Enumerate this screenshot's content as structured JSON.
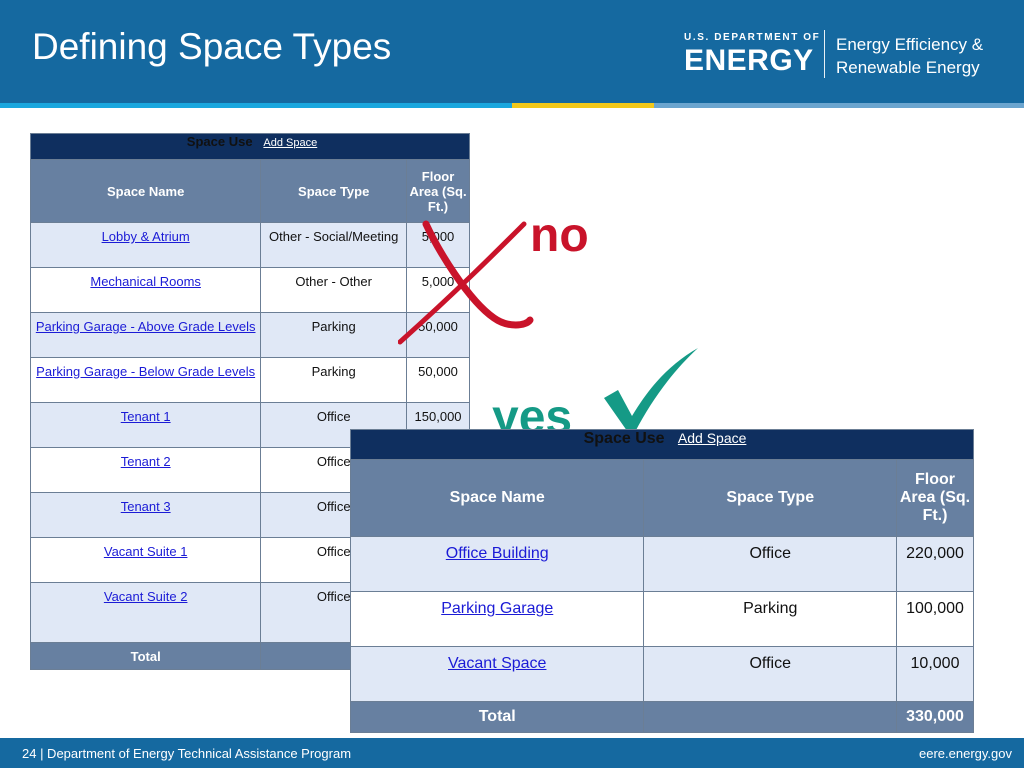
{
  "slide": {
    "title": "Defining Space Types"
  },
  "logo": {
    "small": "U.S. DEPARTMENT OF",
    "big": "ENERGY",
    "eere_line1": "Energy Efficiency &",
    "eere_line2": "Renewable Energy"
  },
  "colors": {
    "header": "#1569a0",
    "stripe_blue": "#1aa7de",
    "stripe_yellow": "#f2c81a",
    "no_red": "#c9132a",
    "yes_teal": "#159a86",
    "table_header": "#6780a1",
    "table_caption": "#0f2f5f",
    "row_alt": "#e0e8f6"
  },
  "icons": {
    "no_mark": "x-mark-icon",
    "yes_mark": "check-mark-icon"
  },
  "table1": {
    "caption": "Space Use",
    "add": "Add Space",
    "headers": [
      "Space Name",
      "Space Type",
      "Floor Area (Sq. Ft.)"
    ],
    "rows": [
      [
        "Lobby & Atrium",
        "Other - Social/Meeting",
        "5,000"
      ],
      [
        "Mechanical Rooms",
        "Other - Other",
        "5,000"
      ],
      [
        "Parking Garage - Above Grade Levels",
        "Parking",
        "50,000"
      ],
      [
        "Parking Garage - Below Grade Levels",
        "Parking",
        "50,000"
      ],
      [
        "Tenant 1",
        "Office",
        "150,000"
      ],
      [
        "Tenant 2",
        "Office",
        ""
      ],
      [
        "Tenant 3",
        "Office",
        ""
      ],
      [
        "Vacant Suite 1",
        "Office",
        ""
      ],
      [
        "Vacant Suite 2",
        "Office",
        ""
      ]
    ],
    "total_label": "Total"
  },
  "table2": {
    "caption": "Space Use",
    "add": "Add Space",
    "headers": [
      "Space Name",
      "Space Type",
      "Floor Area (Sq. Ft.)"
    ],
    "rows": [
      [
        "Office Building",
        "Office",
        "220,000"
      ],
      [
        "Parking Garage",
        "Parking",
        "100,000"
      ],
      [
        "Vacant Space",
        "Office",
        "10,000"
      ]
    ],
    "total_label": "Total",
    "total_value": "330,000"
  },
  "annotations": {
    "no": "no",
    "yes": "yes"
  },
  "footer": {
    "left": "24 | Department of Energy Technical Assistance Program",
    "right": "eere.energy.gov"
  }
}
